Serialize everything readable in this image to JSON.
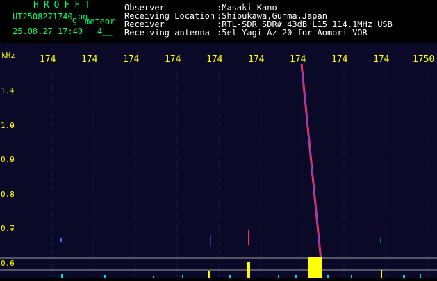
{
  "header": {
    "logo": "HROFFT",
    "filename": "UT2508271740.pn",
    "file_ext": "g",
    "mode": "meteor",
    "datetime": "25.08.27 17:40",
    "count": "4__",
    "fields": [
      {
        "label": "Observer",
        "value": ":Masaki Kano"
      },
      {
        "label": "Receiving Location",
        "value": ":Shibukawa,Gunma,Japan"
      },
      {
        "label": "Receiver",
        "value": ":RTL-SDR SDR# 43dB L15 114.1MHz USB"
      },
      {
        "label": "Receiving antenna",
        "value": ":5el Yagi Az 20 for Aomori VOR"
      }
    ]
  },
  "spectrogram": {
    "y_unit_label": "kHz",
    "x_tick_labels": [
      "174",
      "174",
      "174",
      "174",
      "174",
      "174",
      "174",
      "174",
      "174",
      "1750"
    ],
    "y_tick_labels": [
      "1.1",
      "1.0",
      "0.9",
      "0.8",
      "0.7",
      "0.6"
    ],
    "colors": {
      "background": "#0a0a28",
      "trace_outer": "#ff3050",
      "trace_inner": "#3a50ff",
      "text": "#ffff00",
      "header_text": "#00ff66"
    }
  }
}
